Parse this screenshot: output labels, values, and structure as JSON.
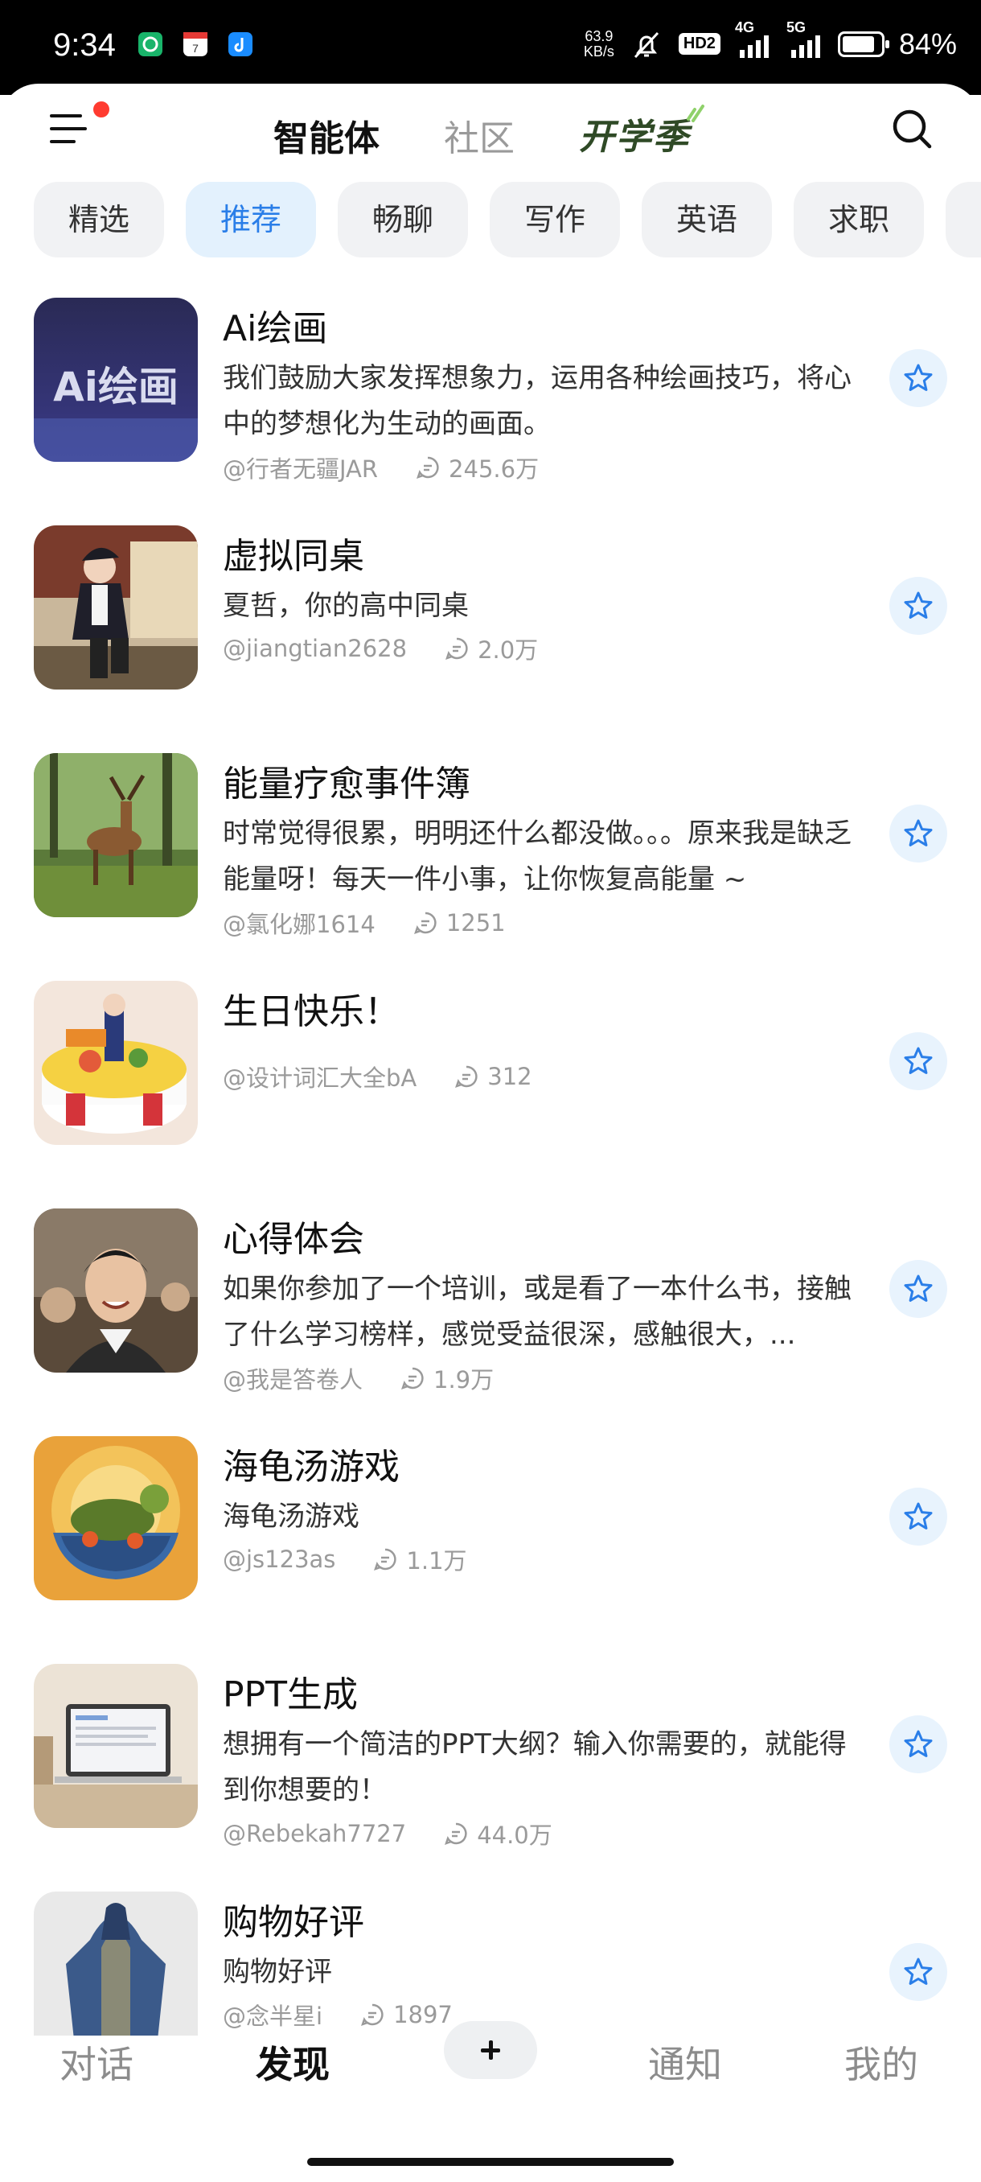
{
  "status_bar": {
    "time": "9:34",
    "net_speed_value": "63.9",
    "net_speed_unit": "KB/s",
    "hd_label": "HD2",
    "net1": "4G",
    "net2": "5G",
    "battery_percent": "84%",
    "battery_level": 0.84
  },
  "top_nav": {
    "menu_icon": "hamburger-menu-icon",
    "has_notification_dot": true,
    "tabs": [
      {
        "label": "智能体",
        "active": true
      },
      {
        "label": "社区",
        "active": false
      },
      {
        "label": "开学季",
        "active": false
      }
    ],
    "search_icon": "search-icon"
  },
  "categories": [
    {
      "label": "精选",
      "active": false
    },
    {
      "label": "推荐",
      "active": true
    },
    {
      "label": "畅聊",
      "active": false
    },
    {
      "label": "写作",
      "active": false
    },
    {
      "label": "英语",
      "active": false
    },
    {
      "label": "求职",
      "active": false
    },
    {
      "label": "",
      "active": false
    }
  ],
  "agents": [
    {
      "title": "Ai绘画",
      "description": "我们鼓励大家发挥想象力，运用各种绘画技巧，将心中的梦想化为生动的画面。",
      "author": "@行者无疆JAR",
      "count": "245.6万",
      "thumb_text": "Ai绘画"
    },
    {
      "title": "虚拟同桌",
      "description": "夏哲，你的高中同桌",
      "author": "@jiangtian2628",
      "count": "2.0万"
    },
    {
      "title": "能量疗愈事件簿",
      "description": "时常觉得很累，明明还什么都没做。。。原来我是缺乏能量呀！每天一件小事，让你恢复高能量 ~",
      "author": "@氯化娜1614",
      "count": "1251"
    },
    {
      "title": "生日快乐！",
      "description": "",
      "author": "@设计词汇大全bA",
      "count": "312"
    },
    {
      "title": "心得体会",
      "description": "如果你参加了一个培训，或是看了一本什么书，接触了什么学习榜样，感觉受益很深，感触很大，...",
      "author": "@我是答卷人",
      "count": "1.9万"
    },
    {
      "title": "海龟汤游戏",
      "description": "海龟汤游戏",
      "author": "@js123as",
      "count": "1.1万"
    },
    {
      "title": "PPT生成",
      "description": "想拥有一个简洁的PPT大纲？输入你需要的，就能得到你想要的！",
      "author": "@Rebekah7727",
      "count": "44.0万"
    },
    {
      "title": "购物好评",
      "description": "购物好评",
      "author": "@念半星i",
      "count": "1897"
    }
  ],
  "bottom_nav": {
    "items": [
      {
        "label": "对话",
        "active": false
      },
      {
        "label": "发现",
        "active": true
      },
      {
        "label": "通知",
        "active": false
      },
      {
        "label": "我的",
        "active": false
      }
    ],
    "plus_icon": "plus-icon"
  },
  "colors": {
    "accent": "#2a7ee8",
    "chip_active_bg": "#e3f1fd",
    "fav_bg": "#e8f3fd",
    "season_green": "#2f4a26",
    "notification_red": "#ff3b30"
  }
}
